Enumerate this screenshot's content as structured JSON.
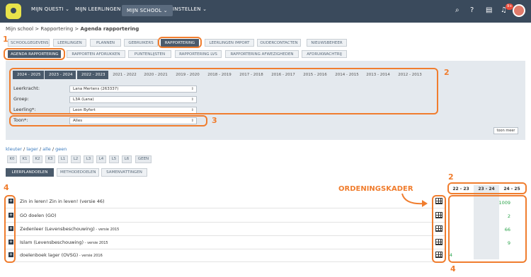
{
  "topbar": {
    "nav": [
      "MIJN QUESTI",
      "MIJN LEERLINGEN",
      "MIJN SCHOOL",
      "INSTELLEN"
    ],
    "badge": "9+"
  },
  "breadcrumb": {
    "root": "Mijn school",
    "sep1": " > ",
    "mid": "Rapportering",
    "sep2": " > ",
    "current": "Agenda rapportering"
  },
  "tabs_row1": [
    "SCHOOLGEGEVENS",
    "LEERLINGEN",
    "PLANNEN",
    "GEBRUIKERS",
    "RAPPORTERING",
    "LEERLINGEN IMPORT",
    "OUDERCONTACTEN",
    "NIEUWSBEHEER"
  ],
  "tabs_row2": [
    "AGENDA RAPPORTERING",
    "RAPPORTEN AFDRUKKEN",
    "PUNTENLIJSTEN",
    "RAPPORTERING LVS",
    "RAPPORTERING AFWEZIGHEDEN",
    "AFDRUKWACHTRIJ"
  ],
  "years": [
    "2024 - 2025",
    "2023 - 2024",
    "2022 - 2023",
    "2021 - 2022",
    "2020 - 2021",
    "2019 - 2020",
    "2018 - 2019",
    "2017 - 2018",
    "2016 - 2017",
    "2015 - 2016",
    "2014 - 2015",
    "2013 - 2014",
    "2012 - 2013"
  ],
  "filters": {
    "leerkracht_label": "Leerkracht:",
    "leerkracht_value": "Lana Mertens (263337)",
    "groep_label": "Groep:",
    "groep_value": "L3A (Lana)",
    "leerling_label": "Leerling*:",
    "leerling_value": "Leon Byfort",
    "toon_label": "Toon*:",
    "toon_value": "Alles",
    "more_button": "toon meer"
  },
  "links": {
    "kleuter": "kleuter",
    "lager": "lager",
    "alle": "alle",
    "geen": "geen",
    "slash": " / "
  },
  "levels": [
    "K0",
    "K1",
    "K2",
    "K3",
    "L1",
    "L2",
    "L3",
    "L4",
    "L5",
    "L6",
    "GEEN"
  ],
  "subtabs": [
    "LEERPLANDOELEN",
    "METHODEDOELEN",
    "SAMENVATTINGEN"
  ],
  "annotations": {
    "n1": "1",
    "n2": "2",
    "n3": "3",
    "n4": "4",
    "ordening": "ORDENINGSKADER"
  },
  "year_cols": [
    "22 - 23",
    "23 - 24",
    "24 - 25"
  ],
  "rows": [
    {
      "label": "Zin in leren! Zin in leven! (versie 46)",
      "small": "",
      "c1": "",
      "c3": "1009"
    },
    {
      "label": "GO doelen (GO)",
      "small": "",
      "c1": "",
      "c3": "2"
    },
    {
      "label": "Zedenleer (Levensbeschouwing)",
      "small": " - versie 2015",
      "c1": "",
      "c3": "66"
    },
    {
      "label": "Islam (Levensbeschouwing)",
      "small": " - versie 2015",
      "c1": "",
      "c3": "9"
    },
    {
      "label": "doelenboek lager (OVSG)",
      "small": " - versie 2016",
      "c1": "4",
      "c3": ""
    }
  ],
  "colors": {
    "topbar": "#3a4a5c",
    "accent": "#f07d2e",
    "count": "#2aa34a"
  }
}
